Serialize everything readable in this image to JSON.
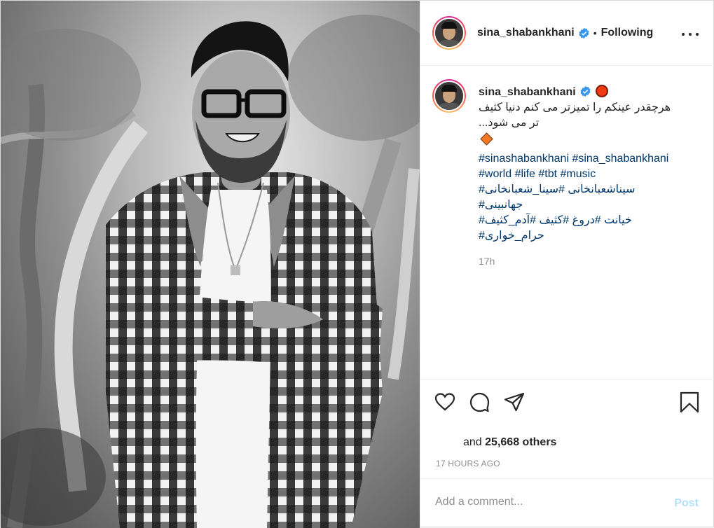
{
  "post": {
    "author": "sina_shabankhani",
    "follow_status": "Following",
    "separator": "•",
    "more_options_icon": "more-horizontal-icon",
    "verified_icon": "verified-badge-icon",
    "colors": {
      "link": "#00376b",
      "muted": "#8e8e8e",
      "post_button": "#b2dffc",
      "verified": "#3897f0",
      "red_circle_emoji": "#f23a12",
      "orange_diamond_emoji": "#f27a27"
    }
  },
  "caption": {
    "username": "sina_shabankhani",
    "emoji_red_circle": "red-circle-emoji",
    "text": "هرچقدر عینکم را تمیزتر می کنم دنیا کثیف\nتر می شود...",
    "emoji_diamond": "orange-diamond-emoji",
    "hashtags": "#sinashabankhani #sina_shabankhani\n#world #life #tbt #music\n#سیناشعبانخانی #سینا_شعبانخانی\n#جهانبینی\n#خیانت #دروغ #کثیف #آدم_کثیف\n#حرام_خواری",
    "time": "17h"
  },
  "actions": {
    "like_icon": "heart-icon",
    "comment_icon": "comment-icon",
    "share_icon": "share-icon",
    "save_icon": "bookmark-icon",
    "likes_prefix": "and",
    "likes_count": "25,668 others",
    "timestamp": "17 HOURS AGO"
  },
  "comment": {
    "placeholder": "Add a comment...",
    "post_label": "Post"
  }
}
